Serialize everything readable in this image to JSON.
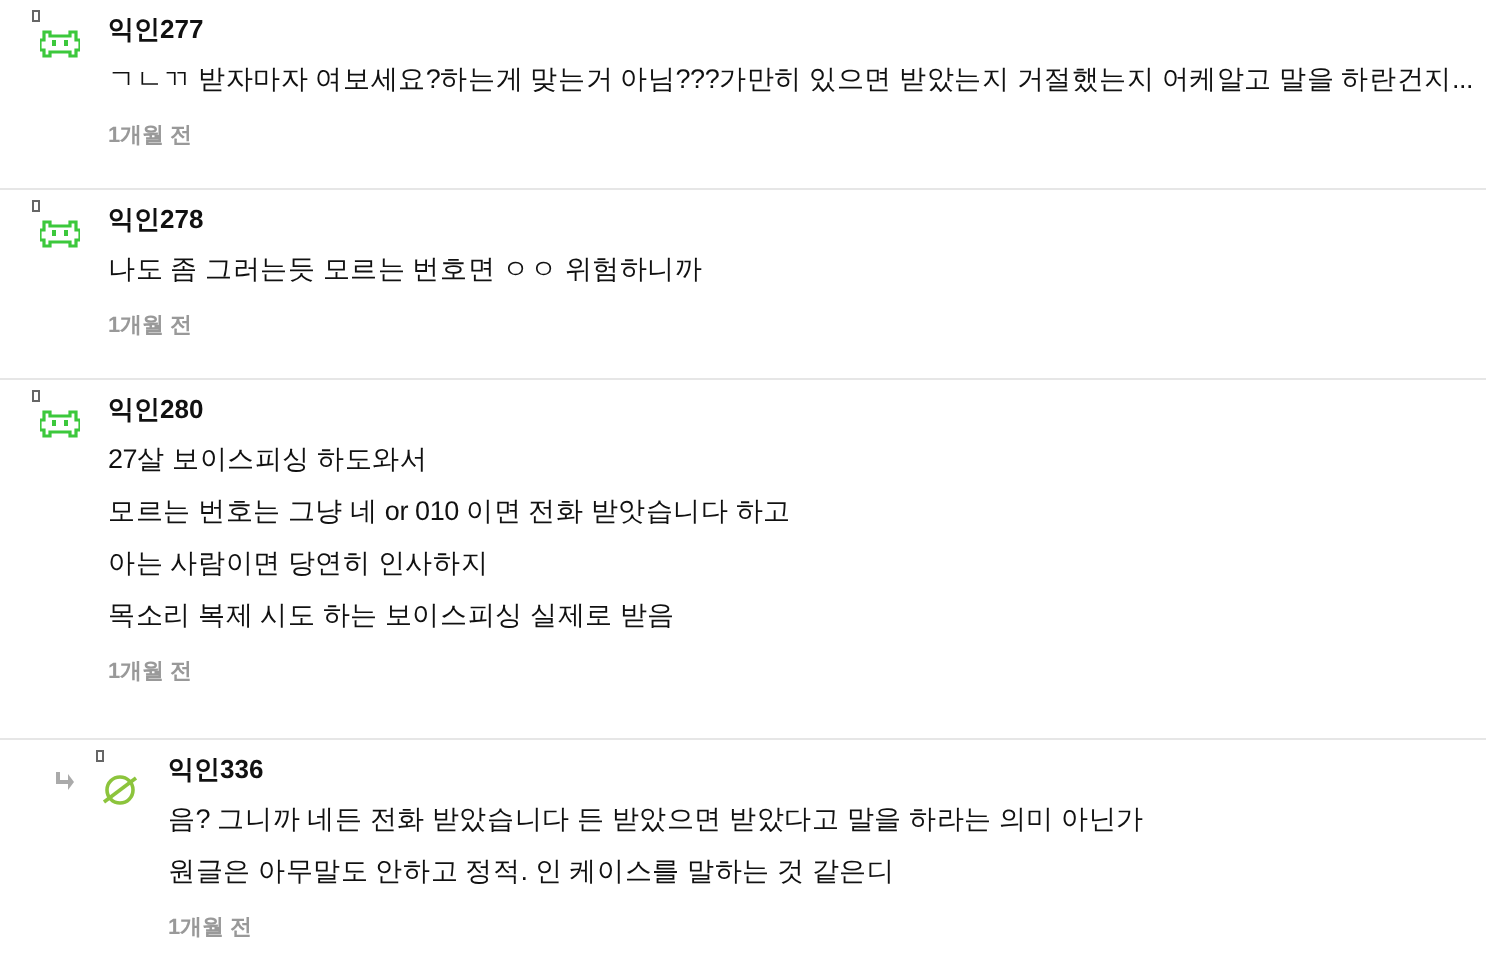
{
  "comments": [
    {
      "kind": "comment",
      "avatar": {
        "kind": "creature"
      },
      "name": "익인277",
      "lines": [
        "ㄱㄴㄲ 받자마자 여보세요?하는게 맞는거 아님???가만히 있으면 받았는지 거절했는지 어케알고 말을 하란건지..."
      ],
      "time": "1개월 전"
    },
    {
      "kind": "comment",
      "avatar": {
        "kind": "creature"
      },
      "name": "익인278",
      "lines": [
        "나도 좀 그러는듯 모르는 번호면 ㅇㅇ 위험하니까"
      ],
      "time": "1개월 전"
    },
    {
      "kind": "comment",
      "avatar": {
        "kind": "creature"
      },
      "name": "익인280",
      "lines": [
        "27살 보이스피싱 하도와서",
        "모르는 번호는 그냥 네 or 010 이면 전화 받앗습니다 하고",
        "아는 사람이면 당연히 인사하지",
        "목소리 복제 시도 하는 보이스피싱 실제로 받음"
      ],
      "time": "1개월 전"
    },
    {
      "kind": "reply",
      "avatar": {
        "kind": "planet"
      },
      "name": "익인336",
      "lines": [
        "음? 그니까 네든 전화 받았습니다 든 받았으면 받았다고 말을 하라는 의미 아닌가",
        "원글은 아무말도 안하고 정적. 인 케이스를 말하는 것 같은디"
      ],
      "time": "1개월 전"
    }
  ]
}
